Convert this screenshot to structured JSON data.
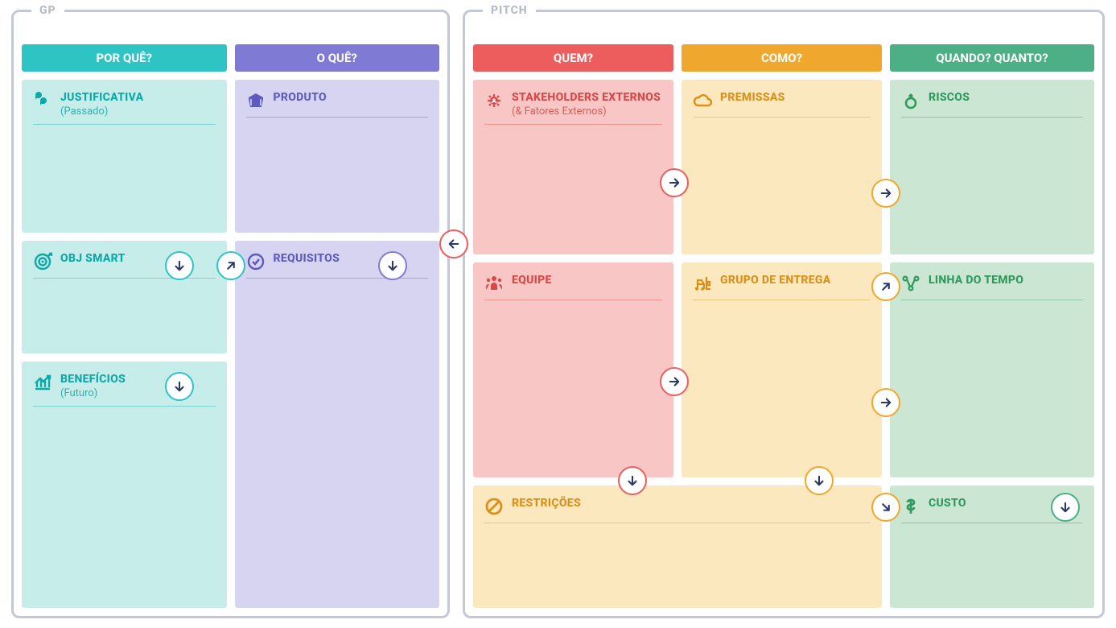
{
  "panels": {
    "gp": {
      "label": "GP"
    },
    "pitch": {
      "label": "PITCH"
    }
  },
  "columns": {
    "why": {
      "header": "POR QUÊ?"
    },
    "what": {
      "header": "O QUÊ?"
    },
    "who": {
      "header": "QUEM?"
    },
    "how": {
      "header": "COMO?"
    },
    "when": {
      "header": "QUANDO? QUANTO?"
    }
  },
  "cards": {
    "justificativa": {
      "title": "JUSTIFICATIVA",
      "sub": "(Passado)"
    },
    "obj": {
      "title": "OBJ SMART"
    },
    "beneficios": {
      "title": "BENEFÍCIOS",
      "sub": "(Futuro)"
    },
    "produto": {
      "title": "PRODUTO"
    },
    "requisitos": {
      "title": "REQUISITOS"
    },
    "stakeholders": {
      "title": "STAKEHOLDERS EXTERNOS",
      "sub": "(& Fatores Externos)"
    },
    "equipe": {
      "title": "EQUIPE"
    },
    "restricoes": {
      "title": "RESTRIÇÕES"
    },
    "premissas": {
      "title": "PREMISSAS"
    },
    "grupo": {
      "title": "GRUPO DE ENTREGA"
    },
    "riscos": {
      "title": "RISCOS"
    },
    "linha": {
      "title": "LINHA DO TEMPO"
    },
    "custo": {
      "title": "CUSTO"
    }
  }
}
